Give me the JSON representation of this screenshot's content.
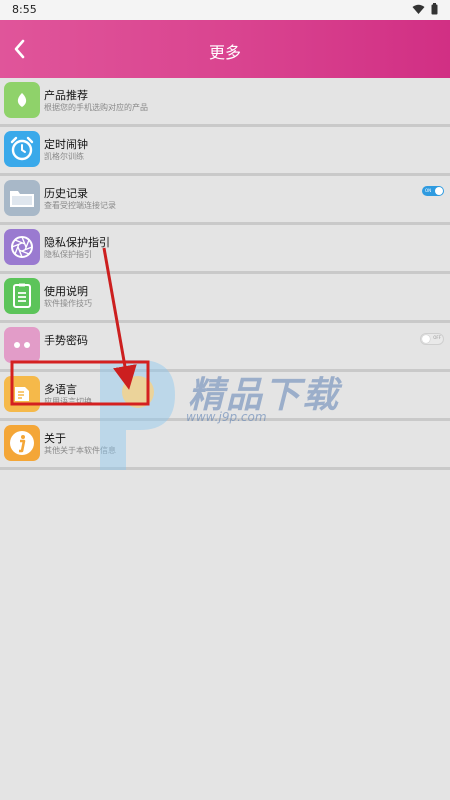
{
  "status_bar": {
    "time": "8:55",
    "wifi_icon": "wifi-icon",
    "battery_icon": "battery-icon"
  },
  "header": {
    "title": "更多",
    "back_icon": "back-arrow-icon",
    "gradient": [
      "#e0559a",
      "#d12f84"
    ]
  },
  "items": [
    {
      "title": "产品推荐",
      "subtitle": "根据您的手机选购对应的产品",
      "icon": "leaf-icon",
      "color": "#8fd26a"
    },
    {
      "title": "定时闹钟",
      "subtitle": "凯格尔训练",
      "icon": "alarm-clock-icon",
      "color": "#3aa9ea"
    },
    {
      "title": "历史记录",
      "subtitle": "查看受控端连接记录",
      "icon": "folder-icon",
      "color": "#a8b8c8",
      "toggle": {
        "state": "on",
        "label": "ON"
      }
    },
    {
      "title": "隐私保护指引",
      "subtitle": "隐私保护指引",
      "icon": "aperture-icon",
      "color": "#9a7ad0"
    },
    {
      "title": "使用说明",
      "subtitle": "软件操作技巧",
      "icon": "document-icon",
      "color": "#5cc45a"
    },
    {
      "title": "手势密码",
      "subtitle": "",
      "icon": "dots-icon",
      "color": "#e29cc8",
      "toggle": {
        "state": "off",
        "label": "OFF"
      }
    },
    {
      "title": "多语言",
      "subtitle": "应用语言切换",
      "icon": "language-icon",
      "color": "#f5b94a"
    },
    {
      "title": "关于",
      "subtitle": "其他关于本软件信息",
      "icon": "info-icon",
      "color": "#f4a637"
    }
  ],
  "annotation": {
    "highlight_color": "#d42020",
    "arrow_color": "#cc1f1f"
  },
  "watermark": {
    "text": "精品下载",
    "url": "www.j9p.com",
    "logo": "p-logo-watermark"
  }
}
